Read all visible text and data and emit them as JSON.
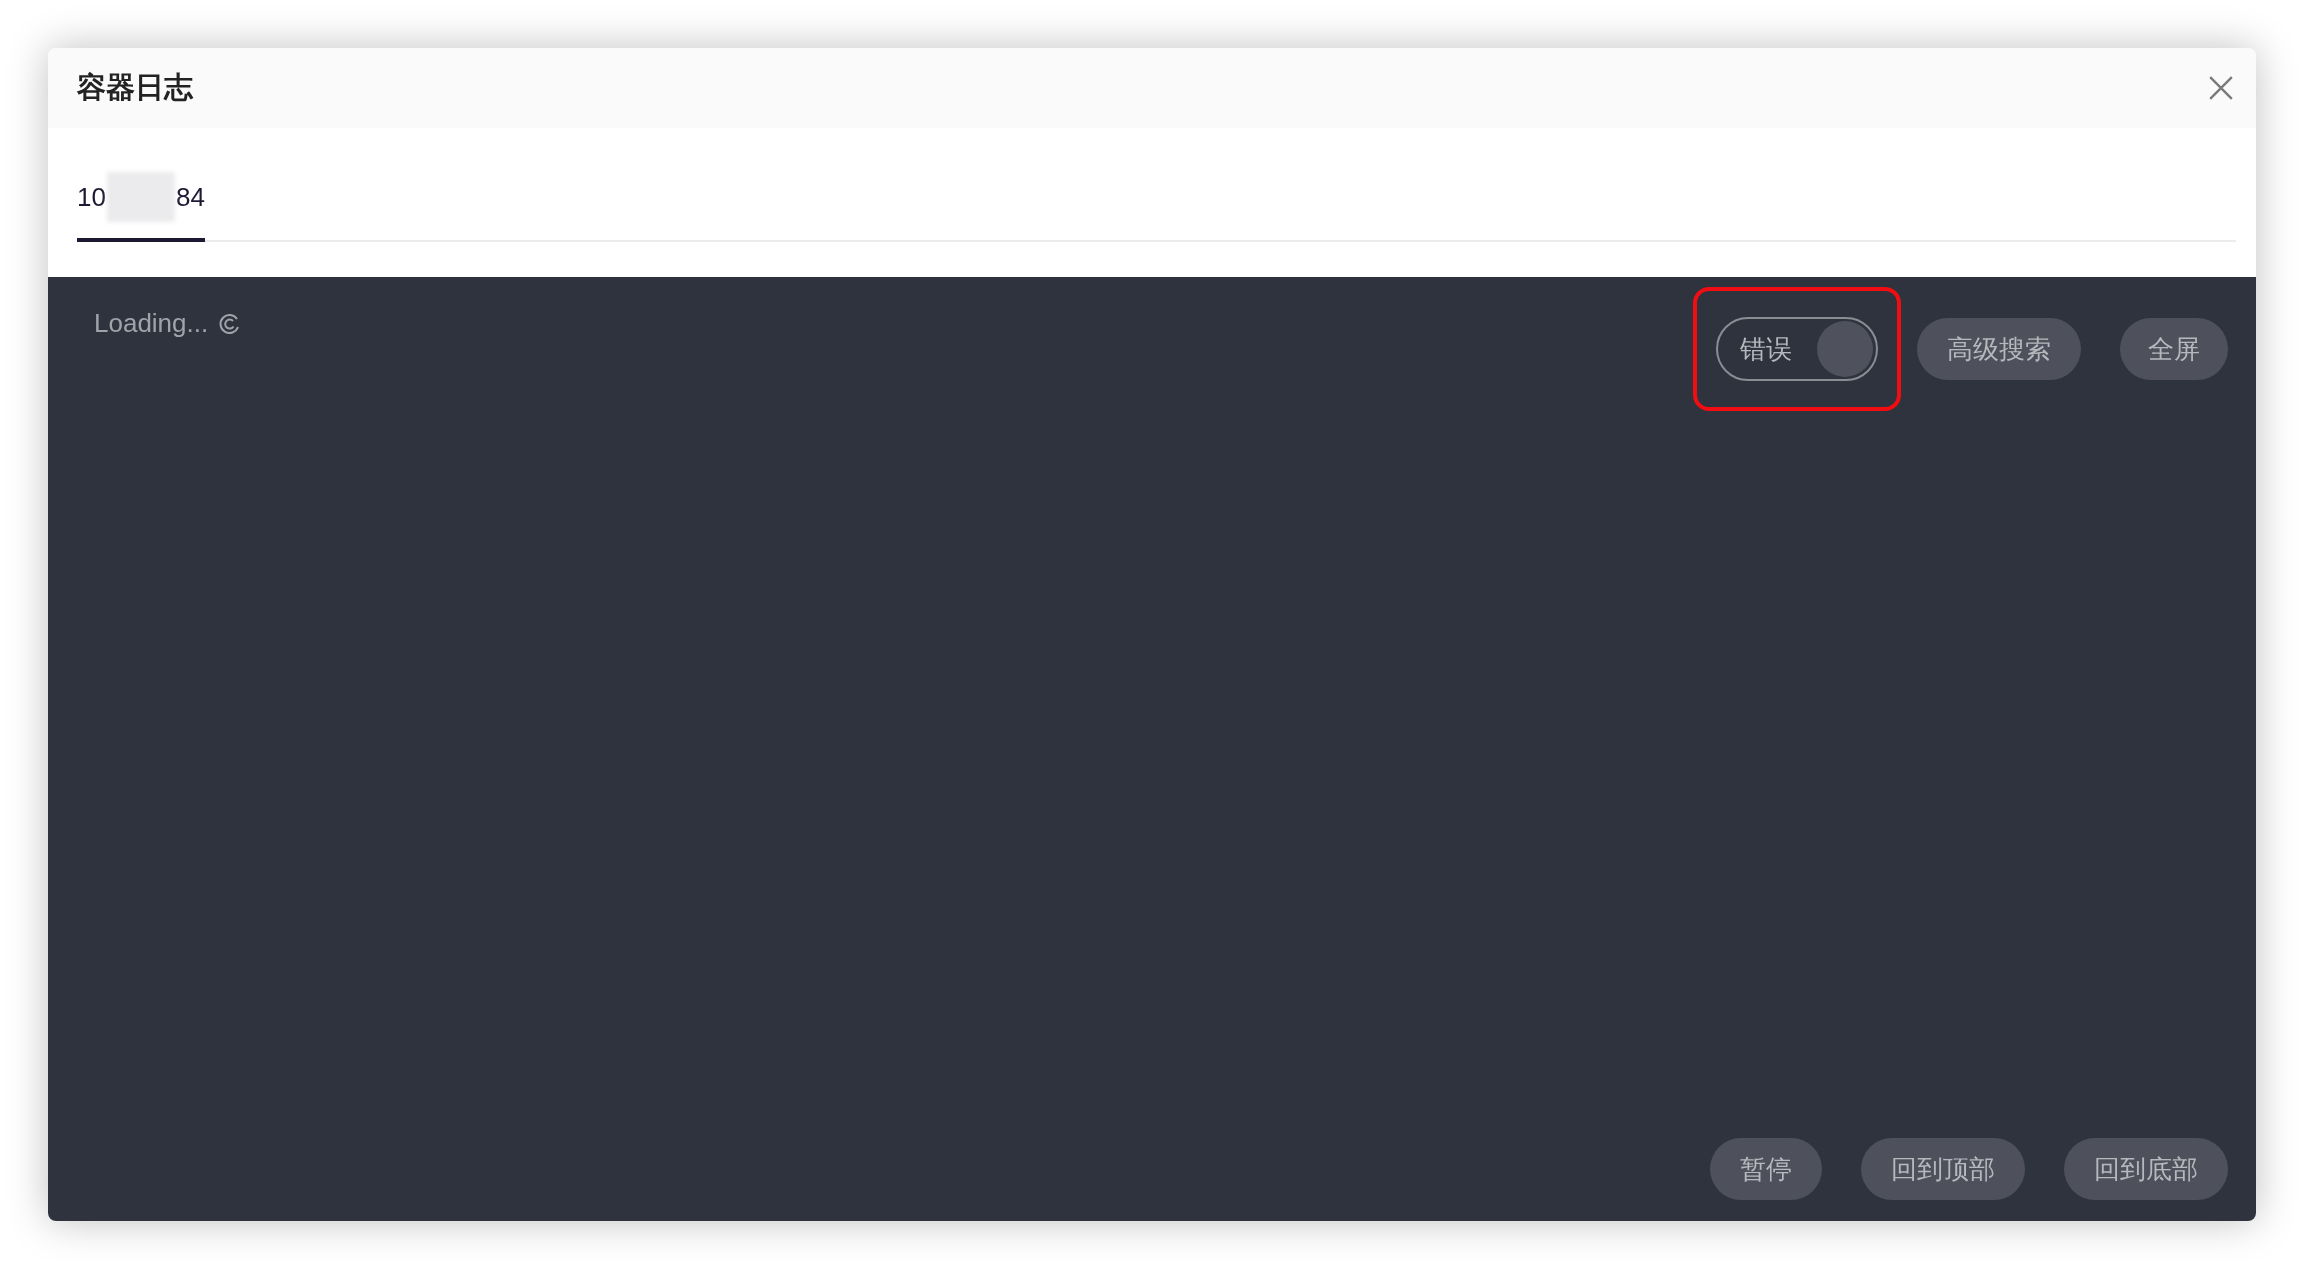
{
  "dialog": {
    "title": "容器日志",
    "close_icon": true
  },
  "tabs": [
    {
      "label_parts": [
        "10",
        "84"
      ],
      "redacted": true,
      "selected": true
    }
  ],
  "log_panel": {
    "status": "Loading...",
    "loading": true,
    "error_toggle": {
      "label": "错误",
      "on": true,
      "highlighted": true
    },
    "top_buttons": [
      "高级搜索",
      "全屏"
    ],
    "bottom_buttons": [
      "暂停",
      "回到顶部",
      "回到底部"
    ]
  }
}
